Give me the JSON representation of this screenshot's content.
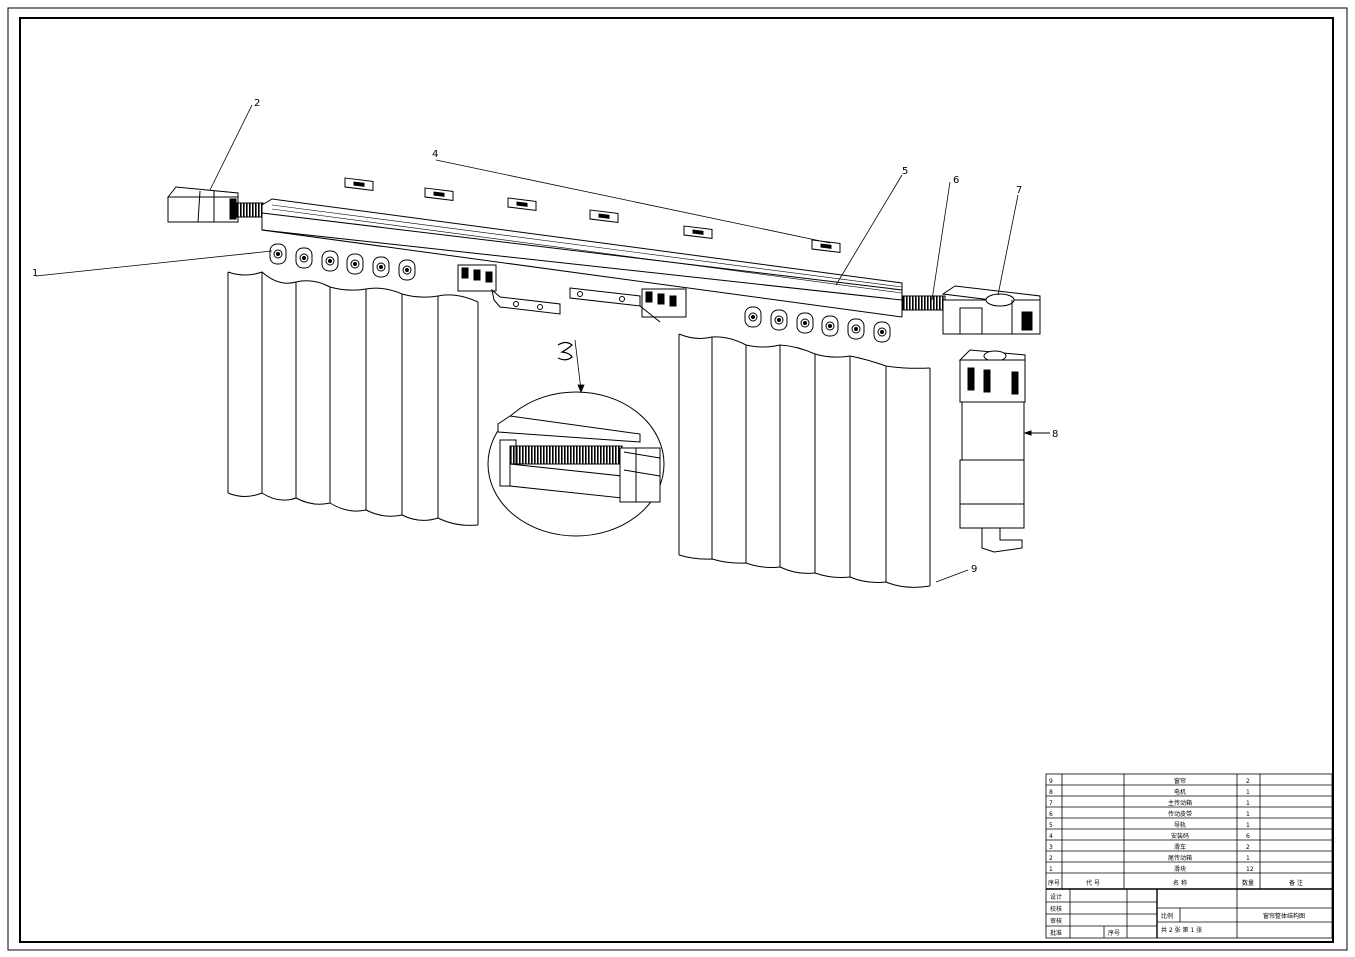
{
  "callouts": [
    "1",
    "2",
    "3",
    "4",
    "5",
    "6",
    "7",
    "8",
    "9"
  ],
  "parts": [
    {
      "no": "9",
      "name": "窗帘",
      "qty": "2"
    },
    {
      "no": "8",
      "name": "电机",
      "qty": "1"
    },
    {
      "no": "7",
      "name": "主传动箱",
      "qty": "1"
    },
    {
      "no": "6",
      "name": "传动皮带",
      "qty": "1"
    },
    {
      "no": "5",
      "name": "导轨",
      "qty": "1"
    },
    {
      "no": "4",
      "name": "安装码",
      "qty": "6"
    },
    {
      "no": "3",
      "name": "滑车",
      "qty": "2"
    },
    {
      "no": "2",
      "name": "尾传动箱",
      "qty": "1"
    },
    {
      "no": "1",
      "name": "滑块",
      "qty": "12"
    }
  ],
  "header": {
    "no": "序号",
    "code": "代  号",
    "name": "名      称",
    "qty": "数量",
    "remark": "备  注"
  },
  "title_block": {
    "design": "设计",
    "check": "校核",
    "review": "审核",
    "approve": "批准",
    "scale": "比例",
    "drawing_title": "窗帘整体结构图",
    "sheet_label": "共 2 张    第 1 张",
    "seq": "序号"
  }
}
